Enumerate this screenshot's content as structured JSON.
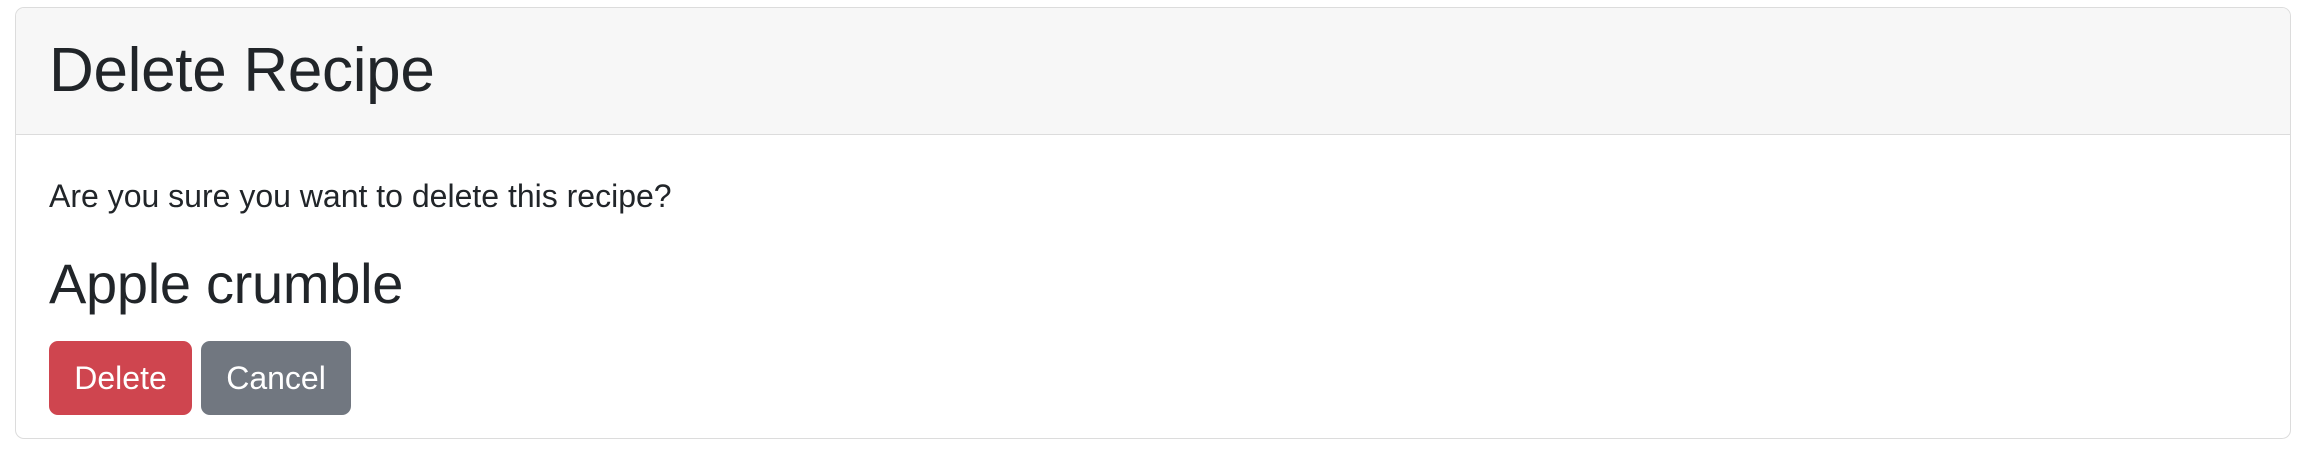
{
  "card": {
    "title": "Delete Recipe",
    "confirm_message": "Are you sure you want to delete this recipe?",
    "recipe_name": "Apple crumble"
  },
  "actions": {
    "delete_label": "Delete",
    "cancel_label": "Cancel"
  },
  "colors": {
    "danger": "#cf454f",
    "secondary": "#717780",
    "header_bg": "#f7f7f7",
    "border": "#dcdcdc",
    "text": "#212529"
  }
}
